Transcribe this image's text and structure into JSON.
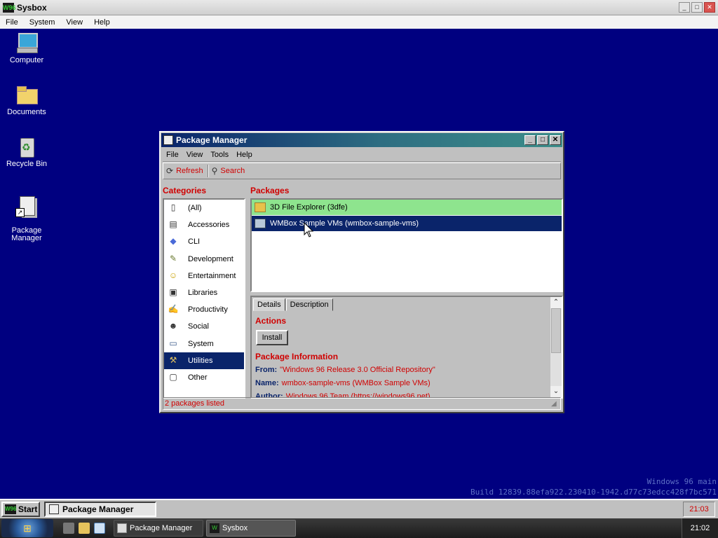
{
  "host": {
    "title": "Sysbox",
    "app_icon": "W96",
    "controls": [
      "minimize",
      "maximize",
      "close"
    ],
    "menu": [
      "File",
      "System",
      "View",
      "Help"
    ]
  },
  "desktop": {
    "background": "#000080",
    "icons": [
      {
        "label": "Computer",
        "icon": "computer-icon"
      },
      {
        "label": "Documents",
        "icon": "folder-icon"
      },
      {
        "label": "Recycle Bin",
        "icon": "recycle-bin-icon"
      },
      {
        "label": "Package\nManager",
        "icon": "package-manager-shortcut-icon"
      }
    ],
    "build_line_1": "Windows 96 main",
    "build_line_2": "Build 12839.88efa922.230410-1942.d77c73edcc428f7bc571"
  },
  "package_manager": {
    "title": "Package Manager",
    "menu": [
      "File",
      "View",
      "Tools",
      "Help"
    ],
    "toolbar": {
      "refresh": "Refresh",
      "search": "Search"
    },
    "categories_heading": "Categories",
    "packages_heading": "Packages",
    "categories": [
      {
        "label": "(All)",
        "icon": "all-icon",
        "glyph": "▯"
      },
      {
        "label": "Accessories",
        "icon": "accessories-icon",
        "glyph": "▤"
      },
      {
        "label": "CLI",
        "icon": "cli-icon",
        "glyph": "◆"
      },
      {
        "label": "Development",
        "icon": "development-icon",
        "glyph": "✎"
      },
      {
        "label": "Entertainment",
        "icon": "entertainment-icon",
        "glyph": "☺"
      },
      {
        "label": "Libraries",
        "icon": "libraries-icon",
        "glyph": "▣"
      },
      {
        "label": "Productivity",
        "icon": "productivity-icon",
        "glyph": "✍"
      },
      {
        "label": "Social",
        "icon": "social-icon",
        "glyph": "☻"
      },
      {
        "label": "System",
        "icon": "system-icon",
        "glyph": "▭"
      },
      {
        "label": "Utilities",
        "icon": "utilities-icon",
        "glyph": "⚒"
      },
      {
        "label": "Other",
        "icon": "other-icon",
        "glyph": "▢"
      }
    ],
    "selected_category": "Utilities",
    "packages": [
      {
        "label": "3D File Explorer (3dfe)",
        "state": "installed",
        "icon": "folder-icon"
      },
      {
        "label": "WMBox Sample VMs (wmbox-sample-vms)",
        "state": "selected",
        "icon": "vm-icon"
      }
    ],
    "tabs": [
      "Details",
      "Description"
    ],
    "active_tab": "Details",
    "actions_heading": "Actions",
    "install_label": "Install",
    "info_heading": "Package Information",
    "info": [
      {
        "key": "From:",
        "value": "\"Windows 96 Release 3.0 Official Repository\""
      },
      {
        "key": "Name:",
        "value": "wmbox-sample-vms (WMBox Sample VMs)"
      },
      {
        "key": "Author:",
        "value": "Windows 96 Team (https://windows96.net)"
      }
    ],
    "status": "2 packages listed"
  },
  "w96_taskbar": {
    "start_label": "Start",
    "task_label": "Package Manager",
    "clock": "21:03"
  },
  "host_taskbar": {
    "tasks": [
      "Package Manager",
      "Sysbox"
    ],
    "clock": "21:02"
  },
  "colors": {
    "accent_red": "#d00000",
    "selection": "#0a246a",
    "installed": "#8ee48e"
  }
}
